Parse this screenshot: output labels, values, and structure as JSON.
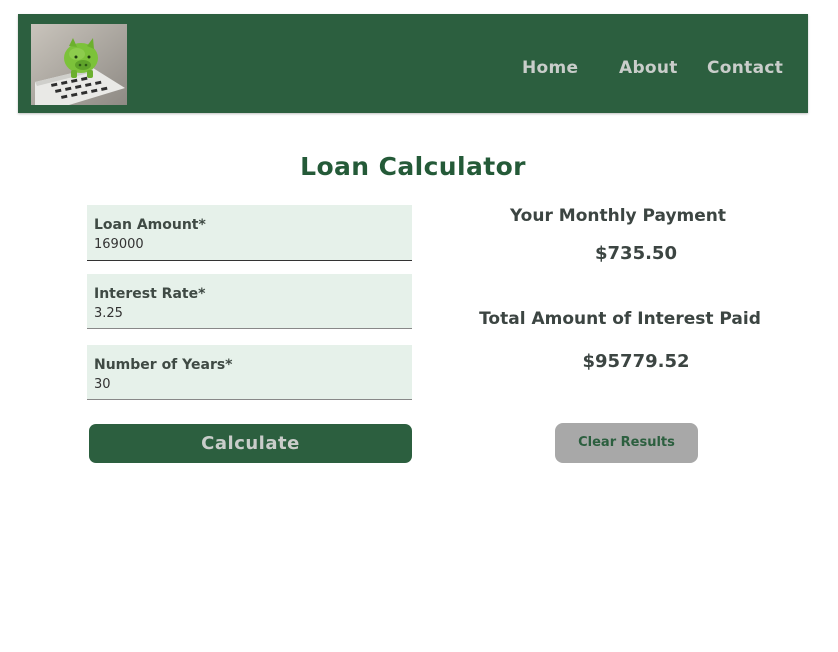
{
  "nav": {
    "links": [
      "Home",
      "About",
      "Contact"
    ]
  },
  "page": {
    "title": "Loan Calculator"
  },
  "form": {
    "fields": [
      {
        "label": "Loan Amount*",
        "value": "169000"
      },
      {
        "label": "Interest Rate*",
        "value": "3.25"
      },
      {
        "label": "Number of Years*",
        "value": "30"
      }
    ],
    "calculate_label": "Calculate"
  },
  "results": {
    "monthly_heading": "Your Monthly Payment",
    "monthly_value": "$735.50",
    "interest_heading": "Total Amount of Interest Paid",
    "interest_value": "$95779.52",
    "clear_label": "Clear Results"
  },
  "colors": {
    "brand_green": "#2c5f3f",
    "field_bg": "#e6f1ea",
    "clear_button_bg": "#a8a8a8"
  }
}
